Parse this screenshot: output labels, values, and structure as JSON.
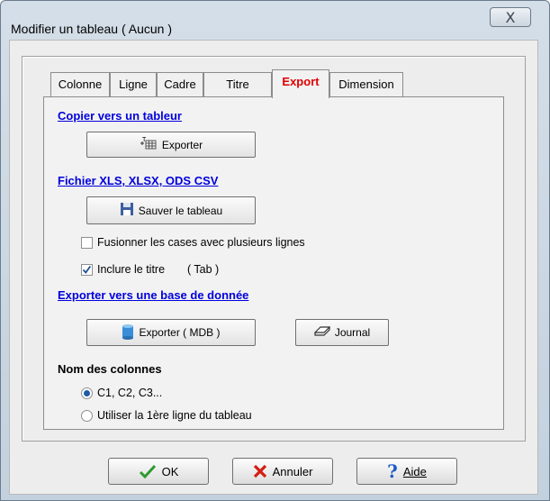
{
  "window": {
    "title": "Modifier un tableau ( Aucun )",
    "close_symbol": "X"
  },
  "tabs": [
    {
      "label": "Colonne"
    },
    {
      "label": "Ligne"
    },
    {
      "label": "Cadre"
    },
    {
      "label": "Titre"
    },
    {
      "label": "Export",
      "active": true
    },
    {
      "label": "Dimension"
    }
  ],
  "export": {
    "copy_section": "Copier vers un tableur",
    "export_button": "Exporter",
    "file_section": "Fichier XLS, XLSX, ODS  CSV",
    "save_button": "Sauver le tableau",
    "merge_checkbox": {
      "label": "Fusionner les cases avec plusieurs lignes",
      "checked": false
    },
    "include_title_checkbox": {
      "label": "Inclure le titre",
      "checked": true
    },
    "tab_hint": "( Tab )",
    "db_section": "Exporter vers une base de donnée",
    "export_mdb_button": "Exporter ( MDB )",
    "journal_button": "Journal",
    "columns_heading": "Nom des colonnes",
    "radio_c1": {
      "label": "C1, C2, C3...",
      "selected": true
    },
    "radio_first_line": {
      "label": "Utiliser la 1ère ligne du tableau",
      "selected": false
    }
  },
  "buttons": {
    "ok": "OK",
    "cancel": "Annuler",
    "help": "Aide"
  },
  "colors": {
    "active_tab": "#e00000",
    "link": "#0000dd"
  }
}
